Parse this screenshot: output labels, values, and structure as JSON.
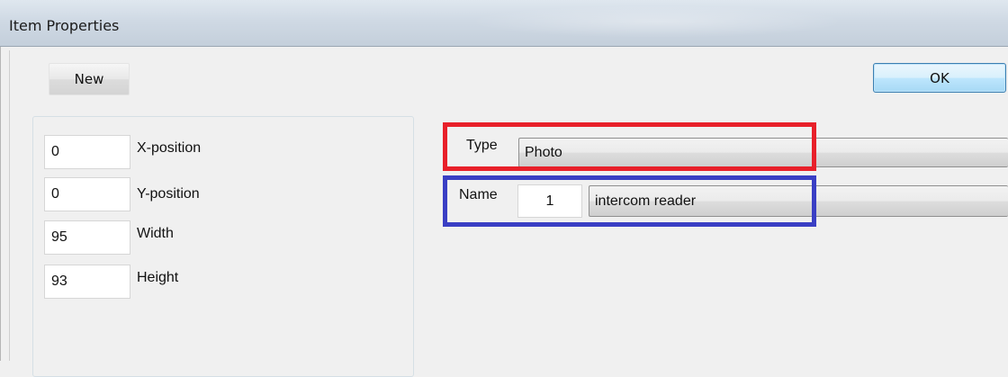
{
  "window": {
    "title": "Item Properties"
  },
  "toolbar": {
    "new_label": "New",
    "ok_label": "OK"
  },
  "geometry_fields": [
    {
      "value": "0",
      "label": "X-position"
    },
    {
      "value": "0",
      "label": "Y-position"
    },
    {
      "value": "95",
      "label": "Width"
    },
    {
      "value": "93",
      "label": "Height"
    }
  ],
  "item": {
    "type_label": "Type",
    "type_value": "Photo",
    "name_label": "Name",
    "name_index": "1",
    "name_value": "intercom reader"
  },
  "colors": {
    "highlight_red": "#e8202a",
    "highlight_blue": "#3a3fc4",
    "ok_button_border": "#3c7fb1"
  }
}
